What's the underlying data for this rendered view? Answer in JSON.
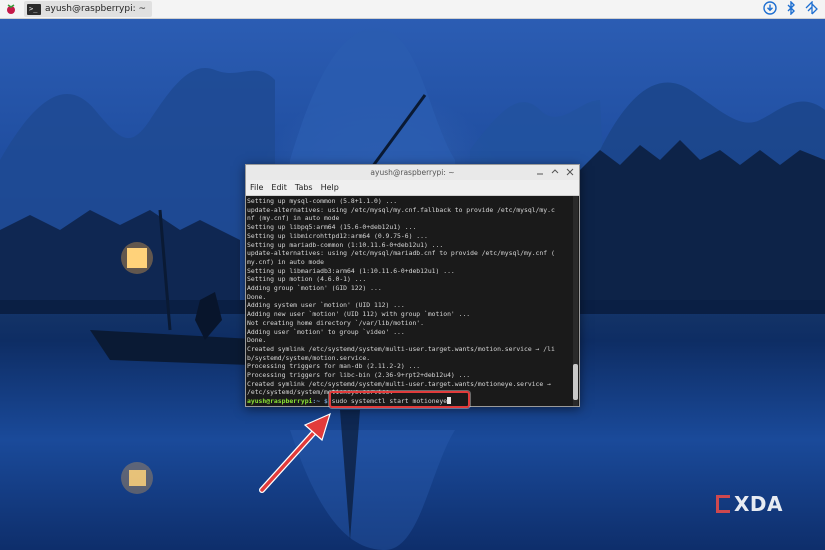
{
  "taskbar": {
    "task_label": "ayush@raspberrypi: ~",
    "icons": [
      "raspberry-menu-icon",
      "terminal-icon",
      "download-icon",
      "bluetooth-icon",
      "wifi-icon"
    ]
  },
  "terminal": {
    "title": "ayush@raspberrypi: ~",
    "menu": [
      "File",
      "Edit",
      "Tabs",
      "Help"
    ],
    "lines": [
      "Setting up mysql-common (5.8+1.1.0) ...",
      "update-alternatives: using /etc/mysql/my.cnf.fallback to provide /etc/mysql/my.c",
      "nf (my.cnf) in auto mode",
      "Setting up libpq5:arm64 (15.6-0+deb12u1) ...",
      "Setting up libmicrohttpd12:arm64 (0.9.75-6) ...",
      "Setting up mariadb-common (1:10.11.6-0+deb12u1) ...",
      "update-alternatives: using /etc/mysql/mariadb.cnf to provide /etc/mysql/my.cnf (",
      "my.cnf) in auto mode",
      "Setting up libmariadb3:arm64 (1:10.11.6-0+deb12u1) ...",
      "Setting up motion (4.6.0-1) ...",
      "Adding group `motion' (GID 122) ...",
      "Done.",
      "Adding system user `motion' (UID 112) ...",
      "Adding new user `motion' (UID 112) with group `motion' ...",
      "Not creating home directory `/var/lib/motion'.",
      "Adding user `motion' to group `video' ...",
      "Done.",
      "Created symlink /etc/systemd/system/multi-user.target.wants/motion.service → /li",
      "b/systemd/system/motion.service.",
      "Processing triggers for man-db (2.11.2-2) ...",
      "Processing triggers for libc-bin (2.36-9+rpt2+deb12u4) ...",
      "Created symlink /etc/systemd/system/multi-user.target.wants/motioneye.service →",
      "/etc/systemd/system/motioneye.service."
    ],
    "prompt_user": "ayush@raspberrypi",
    "prompt_path": ":~ $",
    "command": "sudo systemctl start motioneye"
  },
  "annotation": {
    "color": "#e23b3b"
  },
  "watermark": {
    "text": "XDA"
  }
}
